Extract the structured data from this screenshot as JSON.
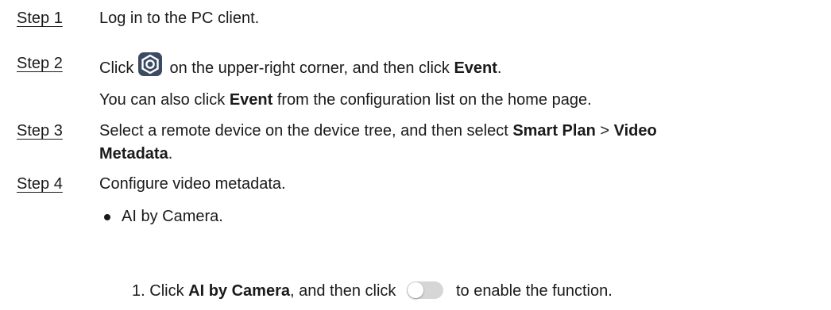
{
  "steps": [
    {
      "label": "Step 1",
      "text": "Log in to the PC client."
    },
    {
      "label": "Step 2",
      "pre": "Click",
      "post": " on the upper-right corner, and then click ",
      "bold": "Event",
      "end": ".",
      "note_pre": "You can also click ",
      "note_bold": "Event",
      "note_post": "  from the configuration list on the home page."
    },
    {
      "label": "Step 3",
      "pre": "Select a remote device on the device tree, and then select ",
      "bold1": "Smart Plan",
      "mid": "  > ",
      "bold2": "Video",
      "bold3": "Metadata",
      "end": "."
    },
    {
      "label": "Step 4",
      "text": "Configure video metadata."
    }
  ],
  "bullet_item": "AI by Camera.",
  "sub_step": {
    "num": "1.",
    "pre": " Click ",
    "bold": "AI by Camera",
    "mid": ", and then click ",
    "post": "to enable the function."
  },
  "icons": [
    "settings-gear-icon",
    "toggle-switch-off-icon"
  ],
  "colors": {
    "text": "#1a1a1a",
    "gear_bg": "#3b4a63",
    "toggle_bg": "#d6d6d6"
  }
}
